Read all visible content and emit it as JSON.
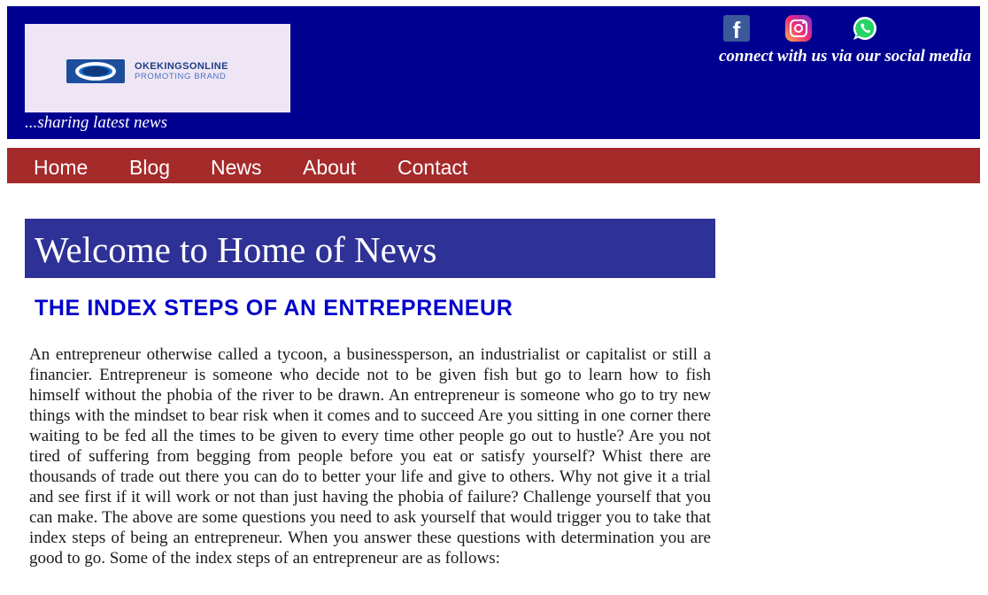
{
  "header": {
    "logo": {
      "title": "OKEKINGSONLINE",
      "subtitle": "PROMOTING BRAND"
    },
    "tagline": "...sharing latest news",
    "social": {
      "icons": [
        "facebook-icon",
        "instagram-icon",
        "whatsapp-icon"
      ],
      "connect_text": "connect with us via our social media"
    }
  },
  "nav": {
    "items": [
      {
        "label": "Home"
      },
      {
        "label": "Blog"
      },
      {
        "label": "News"
      },
      {
        "label": "About"
      },
      {
        "label": "Contact"
      }
    ]
  },
  "main": {
    "welcome": "Welcome to Home of News",
    "article_title": "THE INDEX STEPS OF AN ENTREPRENEUR",
    "article_body": "An entrepreneur otherwise called a tycoon, a businessperson, an industrialist or capitalist or still a financier. Entrepreneur is someone who decide not to be given fish but go to learn how to fish himself without the phobia of the river to be drawn. An entrepreneur is someone who go to try new things with the mindset to bear risk when it comes and to succeed Are you sitting in one corner there waiting to be fed all the times to be given to every time other people go out to hustle? Are you not tired of suffering from begging from people before you eat or satisfy yourself? Whist there are thousands of trade out there you can do to better your life and give to others. Why not give it a trial and see first if it will work or not than just having the phobia of failure? Challenge yourself that you can make. The above are some questions you need to ask yourself that would trigger you to take that index steps of being an entrepreneur. When you answer these questions with determination you are good to go. Some of the index steps of an entrepreneur are as follows:"
  },
  "colors": {
    "header_bg": "#000090",
    "nav_bg": "#a52a2a",
    "welcome_bg": "#2e3195",
    "title_color": "#0000cc"
  }
}
